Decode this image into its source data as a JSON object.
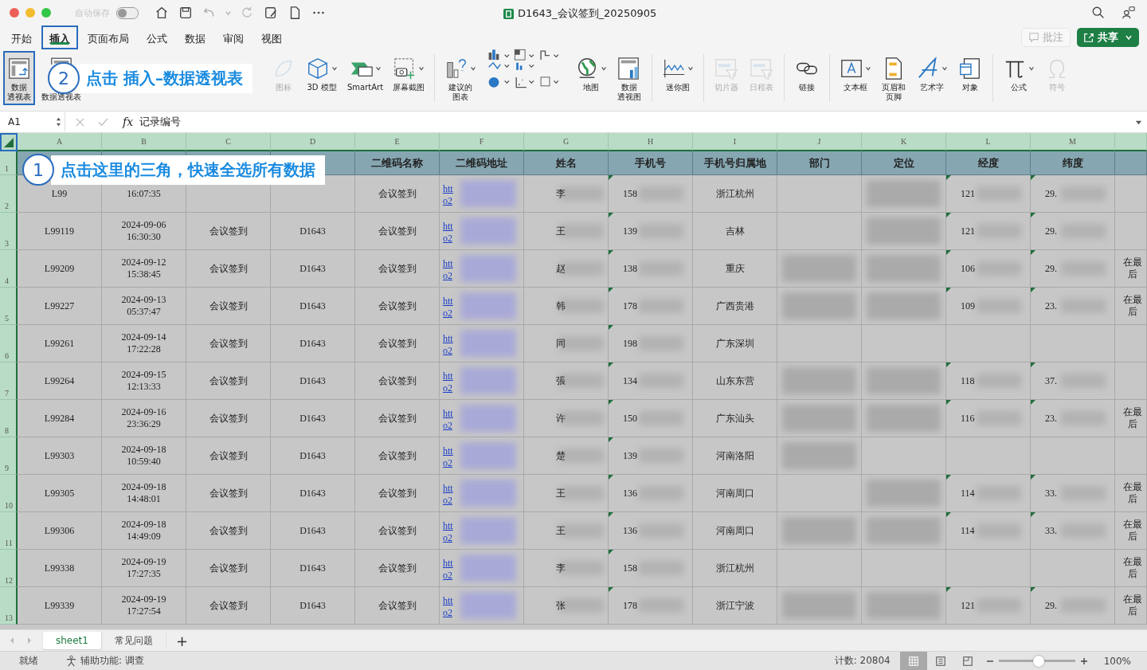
{
  "window": {
    "title": "D1643_会议签到_20250905",
    "autosave": {
      "label": "自动保存",
      "on": false
    }
  },
  "tabs": [
    {
      "label": "开始",
      "selected": false,
      "highlighted": false
    },
    {
      "label": "插入",
      "selected": true,
      "highlighted": true
    },
    {
      "label": "页面布局",
      "selected": false,
      "highlighted": false
    },
    {
      "label": "公式",
      "selected": false,
      "highlighted": false
    },
    {
      "label": "数据",
      "selected": false,
      "highlighted": false
    },
    {
      "label": "审阅",
      "selected": false,
      "highlighted": false
    },
    {
      "label": "视图",
      "selected": false,
      "highlighted": false
    }
  ],
  "comment_button": "批注",
  "share_button": "共享",
  "ribbon": {
    "groups": [
      [
        {
          "kind": "pivot",
          "label_lines": [
            "数据",
            "透视表"
          ],
          "dropdown": false,
          "disabled": false,
          "highlighted": true
        },
        {
          "kind": "pivot2",
          "label_lines": [
            "数据透视表"
          ],
          "dropdown": false,
          "disabled": false,
          "highlighted": false
        }
      ],
      [
        {
          "kind": "image",
          "label_lines": [
            "图标"
          ],
          "dropdown": false,
          "disabled": true,
          "highlighted": false
        },
        {
          "kind": "cube",
          "label_lines": [
            "3D 模型"
          ],
          "dropdown": true,
          "disabled": false,
          "highlighted": false
        },
        {
          "kind": "smartart",
          "label_lines": [
            "SmartArt"
          ],
          "dropdown": true,
          "disabled": false,
          "highlighted": false
        },
        {
          "kind": "screenshot",
          "label_lines": [
            "屏幕截图"
          ],
          "dropdown": true,
          "disabled": false,
          "highlighted": false
        }
      ],
      [
        {
          "kind": "chart",
          "label_lines": [
            "建议的",
            "图表"
          ],
          "dropdown": true,
          "disabled": false,
          "highlighted": false
        },
        {
          "kind": "chartgrid",
          "dropdown": false,
          "disabled": false,
          "highlighted": false
        },
        {
          "kind": "globe",
          "label_lines": [
            "地图"
          ],
          "dropdown": true,
          "disabled": false,
          "highlighted": false
        },
        {
          "kind": "pivotchart",
          "label_lines": [
            "数据",
            "透视图"
          ],
          "dropdown": false,
          "disabled": false,
          "highlighted": false
        }
      ],
      [
        {
          "kind": "sparkline",
          "label_lines": [
            "迷你图"
          ],
          "dropdown": true,
          "disabled": false,
          "highlighted": false
        }
      ],
      [
        {
          "kind": "slicer",
          "label_lines": [
            "切片器"
          ],
          "dropdown": false,
          "disabled": true,
          "highlighted": false
        },
        {
          "kind": "slicer",
          "label_lines": [
            "日程表"
          ],
          "dropdown": false,
          "disabled": true,
          "highlighted": false
        }
      ],
      [
        {
          "kind": "link",
          "label_lines": [
            "链接"
          ],
          "dropdown": false,
          "disabled": false,
          "highlighted": false
        }
      ],
      [
        {
          "kind": "textbox",
          "label_lines": [
            "文本框"
          ],
          "dropdown": true,
          "disabled": false,
          "highlighted": false
        },
        {
          "kind": "header",
          "label_lines": [
            "页眉和",
            "页脚"
          ],
          "dropdown": false,
          "disabled": false,
          "highlighted": false
        },
        {
          "kind": "wordart",
          "label_lines": [
            "艺术字"
          ],
          "dropdown": true,
          "disabled": false,
          "highlighted": false
        },
        {
          "kind": "object",
          "label_lines": [
            "对象"
          ],
          "dropdown": false,
          "disabled": false,
          "highlighted": false
        }
      ],
      [
        {
          "kind": "pi",
          "label_lines": [
            "公式"
          ],
          "dropdown": true,
          "disabled": false,
          "highlighted": false
        },
        {
          "kind": "omega",
          "label_lines": [
            "符号"
          ],
          "dropdown": false,
          "disabled": true,
          "highlighted": false
        }
      ]
    ]
  },
  "formula_bar": {
    "name_box": "A1",
    "fx": "fx",
    "value": "记录编号"
  },
  "grid": {
    "select_all_highlighted": true,
    "header_row_number": "1",
    "columns": [
      {
        "letter": "A",
        "kind": "text"
      },
      {
        "letter": "B",
        "kind": "text"
      },
      {
        "letter": "C",
        "kind": "text"
      },
      {
        "letter": "D",
        "kind": "text"
      },
      {
        "letter": "E",
        "header": "二维码名称",
        "kind": "text"
      },
      {
        "letter": "F",
        "header": "二维码地址",
        "kind": "link"
      },
      {
        "letter": "G",
        "header": "姓名",
        "kind": "masked"
      },
      {
        "letter": "H",
        "header": "手机号",
        "kind": "flagged"
      },
      {
        "letter": "I",
        "header": "手机号归属地",
        "kind": "text"
      },
      {
        "letter": "J",
        "header": "部门",
        "kind": "redacted"
      },
      {
        "letter": "K",
        "header": "定位",
        "kind": "redacted"
      },
      {
        "letter": "L",
        "header": "经度",
        "kind": "flagged"
      },
      {
        "letter": "M",
        "header": "纬度",
        "kind": "flagged"
      },
      {
        "kind": "note"
      }
    ],
    "rows": [
      {
        "number": "2",
        "cells": [
          "L99",
          "16:07:35",
          null,
          null,
          "会议签到",
          "htt\no2",
          "李",
          "158",
          "浙江杭州",
          false,
          true,
          "121",
          "29.",
          null
        ]
      },
      {
        "number": "3",
        "cells": [
          "L99119",
          "2024-09-06\n16:30:30",
          "会议签到",
          "D1643",
          "会议签到",
          "htt\no2",
          "王",
          "139",
          "吉林",
          false,
          true,
          "121",
          "29.",
          null
        ]
      },
      {
        "number": "4",
        "cells": [
          "L99209",
          "2024-09-12\n15:38:45",
          "会议签到",
          "D1643",
          "会议签到",
          "htt\no2",
          "赵",
          "138",
          "重庆",
          true,
          true,
          "106",
          "29.",
          "在最后"
        ]
      },
      {
        "number": "5",
        "cells": [
          "L99227",
          "2024-09-13\n05:37:47",
          "会议签到",
          "D1643",
          "会议签到",
          "htt\no2",
          "韩",
          "178",
          "广西贵港",
          true,
          true,
          "109",
          "23.",
          "在最后"
        ]
      },
      {
        "number": "6",
        "cells": [
          "L99261",
          "2024-09-14\n17:22:28",
          "会议签到",
          "D1643",
          "会议签到",
          "htt\no2",
          "同",
          "198",
          "广东深圳",
          false,
          false,
          null,
          null,
          null
        ]
      },
      {
        "number": "7",
        "cells": [
          "L99264",
          "2024-09-15\n12:13:33",
          "会议签到",
          "D1643",
          "会议签到",
          "htt\no2",
          "張",
          "134",
          "山东东营",
          true,
          true,
          "118",
          "37.",
          null
        ]
      },
      {
        "number": "8",
        "cells": [
          "L99284",
          "2024-09-16\n23:36:29",
          "会议签到",
          "D1643",
          "会议签到",
          "htt\no2",
          "许",
          "150",
          "广东汕头",
          true,
          true,
          "116",
          "23.",
          "在最后"
        ]
      },
      {
        "number": "9",
        "cells": [
          "L99303",
          "2024-09-18\n10:59:40",
          "会议签到",
          "D1643",
          "会议签到",
          "htt\no2",
          "楚",
          "139",
          "河南洛阳",
          true,
          false,
          null,
          null,
          null
        ]
      },
      {
        "number": "10",
        "cells": [
          "L99305",
          "2024-09-18\n14:48:01",
          "会议签到",
          "D1643",
          "会议签到",
          "htt\no2",
          "王",
          "136",
          "河南周口",
          false,
          true,
          "114",
          "33.",
          "在最后"
        ]
      },
      {
        "number": "11",
        "cells": [
          "L99306",
          "2024-09-18\n14:49:09",
          "会议签到",
          "D1643",
          "会议签到",
          "htt\no2",
          "王",
          "136",
          "河南周口",
          true,
          true,
          "114",
          "33.",
          "在最后"
        ]
      },
      {
        "number": "12",
        "cells": [
          "L99338",
          "2024-09-19\n17:27:35",
          "会议签到",
          "D1643",
          "会议签到",
          "htt\no2",
          "李",
          "158",
          "浙江杭州",
          false,
          false,
          null,
          null,
          "在最后"
        ]
      },
      {
        "number": "13",
        "cells": [
          "L99339",
          "2024-09-19\n17:27:54",
          "会议签到",
          "D1643",
          "会议签到",
          "htt\no2",
          "张",
          "178",
          "浙江宁波",
          true,
          true,
          "121",
          "29.",
          "在最后"
        ]
      }
    ]
  },
  "callouts": [
    {
      "number": "2",
      "text": "点击 插入–数据透视表",
      "kind": "ribbon"
    },
    {
      "number": "1",
      "text": "点击这里的三角，快速全选所有数据",
      "kind": "grid"
    }
  ],
  "sheet_tabs": [
    {
      "label": "sheet1",
      "selected": true
    },
    {
      "label": "常见问题",
      "selected": false
    }
  ],
  "add_sheet": "+",
  "status_bar": {
    "ready": "就绪",
    "accessibility": "辅助功能: 调查",
    "count": "计数: 20804",
    "zoom": {
      "level": 0.52,
      "reading": "100%"
    },
    "view_buttons": [
      {
        "kind": "normal",
        "selected": true
      },
      {
        "kind": "layout",
        "selected": false
      },
      {
        "kind": "break",
        "selected": false
      }
    ]
  }
}
